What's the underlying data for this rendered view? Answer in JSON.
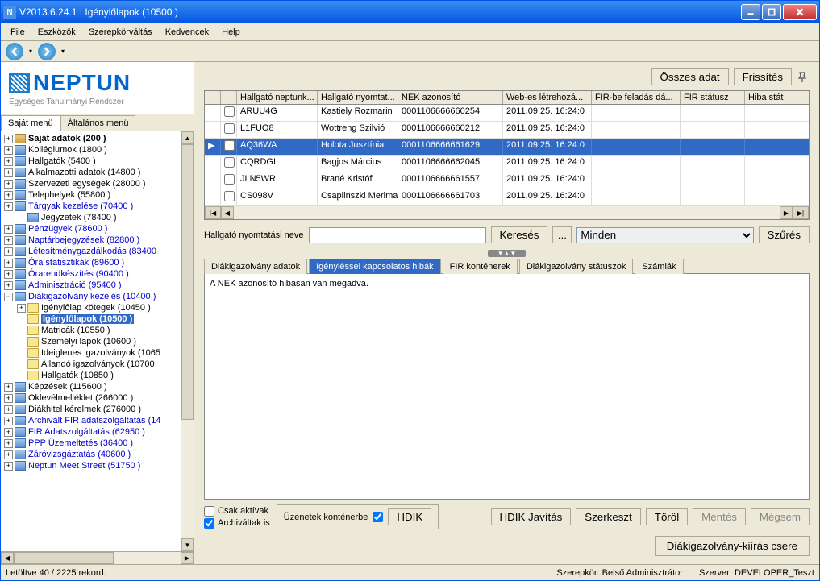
{
  "titlebar": {
    "text": "V2013.6.24.1 : Igénylőlapok (10500  )"
  },
  "menu": {
    "items": [
      "File",
      "Eszközök",
      "Szerepkörváltás",
      "Kedvencek",
      "Help"
    ]
  },
  "logo": {
    "title": "NEPTUN",
    "subtitle": "Egységes Tanulmányi Rendszer"
  },
  "sidebarTabs": {
    "active": "Saját menü",
    "other": "Általános menü"
  },
  "tree": [
    {
      "level": 1,
      "exp": "+",
      "icon": "folder",
      "label": "Saját adatok (200  )",
      "bold": true
    },
    {
      "level": 1,
      "exp": "+",
      "icon": "folder-b",
      "label": "Kollégiumok (1800  )"
    },
    {
      "level": 1,
      "exp": "+",
      "icon": "folder-b",
      "label": "Hallgatók (5400  )"
    },
    {
      "level": 1,
      "exp": "+",
      "icon": "folder-b",
      "label": "Alkalmazotti adatok (14800  )"
    },
    {
      "level": 1,
      "exp": "+",
      "icon": "folder-b",
      "label": "Szervezeti egységek (28000  )"
    },
    {
      "level": 1,
      "exp": "+",
      "icon": "folder-b",
      "label": "Telephelyek (55800  )"
    },
    {
      "level": 1,
      "exp": "+",
      "icon": "folder-b",
      "label": "Tárgyak kezelése (70400  )",
      "blue": true
    },
    {
      "level": 2,
      "exp": "",
      "icon": "folder-b",
      "label": "Jegyzetek (78400  )"
    },
    {
      "level": 1,
      "exp": "+",
      "icon": "folder-b",
      "label": "Pénzügyek (78600  )",
      "blue": true
    },
    {
      "level": 1,
      "exp": "+",
      "icon": "folder-b",
      "label": "Naptárbejegyzések (82800  )",
      "blue": true
    },
    {
      "level": 1,
      "exp": "+",
      "icon": "folder-b",
      "label": "Létesítménygazdálkodás (83400",
      "blue": true
    },
    {
      "level": 1,
      "exp": "+",
      "icon": "folder-b",
      "label": "Óra statisztikák (89600  )",
      "blue": true
    },
    {
      "level": 1,
      "exp": "+",
      "icon": "folder-b",
      "label": "Órarendkészítés (90400  )",
      "blue": true
    },
    {
      "level": 1,
      "exp": "+",
      "icon": "folder-b",
      "label": "Adminisztráció (95400  )",
      "blue": true
    },
    {
      "level": 1,
      "exp": "−",
      "icon": "folder-b",
      "label": "Diákigazolvány kezelés (10400  )",
      "blue": true
    },
    {
      "level": 2,
      "exp": "+",
      "icon": "doc-y",
      "label": "Igénylőlap kötegek (10450  )"
    },
    {
      "level": 2,
      "exp": "",
      "icon": "doc-y",
      "label": "Igénylőlapok (10500  )",
      "selected": true
    },
    {
      "level": 2,
      "exp": "",
      "icon": "doc-y",
      "label": "Matricák (10550  )"
    },
    {
      "level": 2,
      "exp": "",
      "icon": "doc-y",
      "label": "Személyi lapok (10600  )"
    },
    {
      "level": 2,
      "exp": "",
      "icon": "doc-y",
      "label": "Ideiglenes igazolványok (1065"
    },
    {
      "level": 2,
      "exp": "",
      "icon": "doc-y",
      "label": "Állandó igazolványok (10700"
    },
    {
      "level": 2,
      "exp": "",
      "icon": "doc-y",
      "label": "Hallgatók (10850  )"
    },
    {
      "level": 1,
      "exp": "+",
      "icon": "folder-b",
      "label": "Képzések (115600  )"
    },
    {
      "level": 1,
      "exp": "+",
      "icon": "folder-b",
      "label": "Oklevélmelléklet (266000  )"
    },
    {
      "level": 1,
      "exp": "+",
      "icon": "folder-b",
      "label": "Diákhitel kérelmek (276000  )"
    },
    {
      "level": 1,
      "exp": "+",
      "icon": "folder-b",
      "label": "Archivált FIR adatszolgáltatás (14",
      "blue": true
    },
    {
      "level": 1,
      "exp": "+",
      "icon": "folder-b",
      "label": "FIR Adatszolgáltatás (62950  )",
      "blue": true
    },
    {
      "level": 1,
      "exp": "+",
      "icon": "folder-b",
      "label": "PPP Üzemeltetés (36400  )",
      "blue": true
    },
    {
      "level": 1,
      "exp": "+",
      "icon": "folder-b",
      "label": "Záróvizsgáztatás (40600  )",
      "blue": true
    },
    {
      "level": 1,
      "exp": "+",
      "icon": "folder-b",
      "label": "Neptun Meet Street (51750  )",
      "blue": true
    }
  ],
  "topButtons": {
    "allData": "Összes adat",
    "refresh": "Frissítés"
  },
  "grid": {
    "headers": [
      "Hallgató neptunk...",
      "Hallgató nyomtat...",
      "NEK azonosító",
      "Web-es létrehozá...",
      "FIR-be feladás dá...",
      "FIR státusz",
      "Hiba stát"
    ],
    "rows": [
      {
        "sel": false,
        "cells": [
          "ARUU4G",
          "Kastiely Rozmarin",
          "0001106666660254",
          "2011.09.25. 16:24:0",
          "",
          "",
          ""
        ]
      },
      {
        "sel": false,
        "cells": [
          "L1FUO8",
          "Wottreng Szilvió",
          "0001106666660212",
          "2011.09.25. 16:24:0",
          "",
          "",
          ""
        ]
      },
      {
        "sel": true,
        "cells": [
          "AQ36WA",
          "Holota Jusztínia",
          "0001106666661629",
          "2011.09.25. 16:24:0",
          "",
          "",
          ""
        ]
      },
      {
        "sel": false,
        "cells": [
          "CQRDGI",
          "Bagjos Március",
          "0001106666662045",
          "2011.09.25. 16:24:0",
          "",
          "",
          ""
        ]
      },
      {
        "sel": false,
        "cells": [
          "JLN5WR",
          "Brané Kristóf",
          "0001106666661557",
          "2011.09.25. 16:24:0",
          "",
          "",
          ""
        ]
      },
      {
        "sel": false,
        "cells": [
          "CS098V",
          "Csaplinszki Merima",
          "0001106666661703",
          "2011.09.25. 16:24:0",
          "",
          "",
          ""
        ]
      }
    ]
  },
  "search": {
    "label": "Hallgató nyomtatási neve",
    "value": "",
    "searchBtn": "Keresés",
    "ellipsis": "...",
    "filterSel": "Minden",
    "filterBtn": "Szűrés"
  },
  "detailTabs": [
    "Diákigazolvány adatok",
    "Igényléssel kapcsolatos hibák",
    "FIR konténerek",
    "Diákigazolvány státuszok",
    "Számlák"
  ],
  "detailTabActive": 1,
  "detailMessage": "A NEK azonosító hibásan van megadva.",
  "bottom": {
    "onlyActive": "Csak aktívak",
    "archivedToo": "Archiváltak is",
    "archivedChecked": true,
    "msgToContainer": "Üzenetek konténerbe",
    "msgChecked": true,
    "hdik": "HDIK",
    "hdikFix": "HDIK Javítás",
    "edit": "Szerkeszt",
    "delete": "Töröl",
    "save": "Mentés",
    "cancel": "Mégsem",
    "bigBtn": "Diákigazolvány-kiírás csere"
  },
  "status": {
    "records": "Letöltve 40 / 2225 rekord.",
    "role": "Szerepkör: Belső Adminisztrátor",
    "server": "Szerver: DEVELOPER_Teszt"
  }
}
